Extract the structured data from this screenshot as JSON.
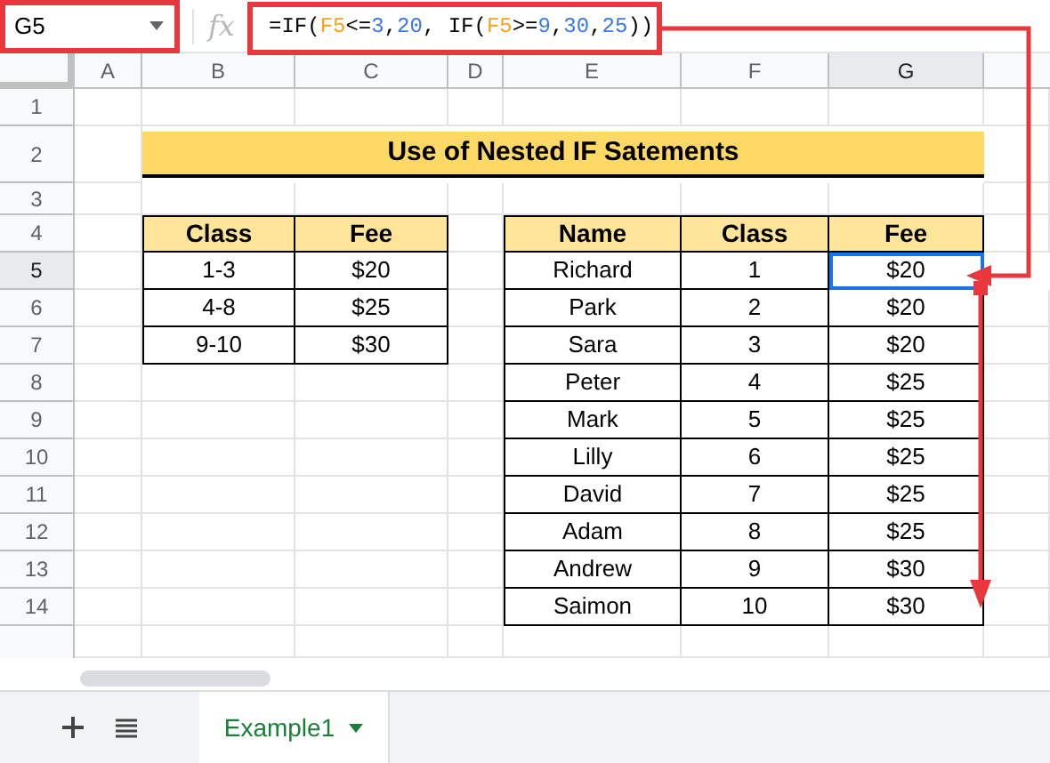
{
  "name_box": {
    "value": "G5"
  },
  "formula_bar": {
    "fx_label": "fx",
    "tokens": [
      {
        "text": "=IF(",
        "kind": "plain"
      },
      {
        "text": "F5",
        "kind": "ref"
      },
      {
        "text": "<=",
        "kind": "plain"
      },
      {
        "text": "3",
        "kind": "number"
      },
      {
        "text": ",",
        "kind": "plain"
      },
      {
        "text": "20",
        "kind": "number"
      },
      {
        "text": ", IF(",
        "kind": "plain"
      },
      {
        "text": "F5",
        "kind": "ref"
      },
      {
        "text": ">=",
        "kind": "plain"
      },
      {
        "text": "9",
        "kind": "number"
      },
      {
        "text": ",",
        "kind": "plain"
      },
      {
        "text": "30",
        "kind": "number"
      },
      {
        "text": ",",
        "kind": "plain"
      },
      {
        "text": "25",
        "kind": "number"
      },
      {
        "text": "))",
        "kind": "plain"
      }
    ]
  },
  "column_headers": [
    {
      "label": "A",
      "selected": false
    },
    {
      "label": "B",
      "selected": false
    },
    {
      "label": "C",
      "selected": false
    },
    {
      "label": "D",
      "selected": false
    },
    {
      "label": "E",
      "selected": false
    },
    {
      "label": "F",
      "selected": false
    },
    {
      "label": "G",
      "selected": true
    }
  ],
  "row_headers": [
    {
      "label": "1",
      "selected": false
    },
    {
      "label": "2",
      "selected": false
    },
    {
      "label": "3",
      "selected": false
    },
    {
      "label": "4",
      "selected": false
    },
    {
      "label": "5",
      "selected": true
    },
    {
      "label": "6",
      "selected": false
    },
    {
      "label": "7",
      "selected": false
    },
    {
      "label": "8",
      "selected": false
    },
    {
      "label": "9",
      "selected": false
    },
    {
      "label": "10",
      "selected": false
    },
    {
      "label": "11",
      "selected": false
    },
    {
      "label": "12",
      "selected": false
    },
    {
      "label": "13",
      "selected": false
    },
    {
      "label": "14",
      "selected": false
    }
  ],
  "title": "Use of Nested IF Satements",
  "fee_table": {
    "columns": [
      "Class",
      "Fee"
    ],
    "rows": [
      [
        "1-3",
        "$20"
      ],
      [
        "4-8",
        "$25"
      ],
      [
        "9-10",
        "$30"
      ]
    ]
  },
  "student_table": {
    "columns": [
      "Name",
      "Class",
      "Fee"
    ],
    "rows": [
      {
        "name": "Richard",
        "class": "1",
        "fee": "$20",
        "selected": true
      },
      {
        "name": "Park",
        "class": "2",
        "fee": "$20",
        "selected": false
      },
      {
        "name": "Sara",
        "class": "3",
        "fee": "$20",
        "selected": false
      },
      {
        "name": "Peter",
        "class": "4",
        "fee": "$25",
        "selected": false
      },
      {
        "name": "Mark",
        "class": "5",
        "fee": "$25",
        "selected": false
      },
      {
        "name": "Lilly",
        "class": "6",
        "fee": "$25",
        "selected": false
      },
      {
        "name": "David",
        "class": "7",
        "fee": "$25",
        "selected": false
      },
      {
        "name": "Adam",
        "class": "8",
        "fee": "$25",
        "selected": false
      },
      {
        "name": "Andrew",
        "class": "9",
        "fee": "$30",
        "selected": false
      },
      {
        "name": "Saimon",
        "class": "10",
        "fee": "$30",
        "selected": false
      }
    ]
  },
  "sheet_tabs": [
    {
      "label": "Example1",
      "selected": true
    }
  ]
}
